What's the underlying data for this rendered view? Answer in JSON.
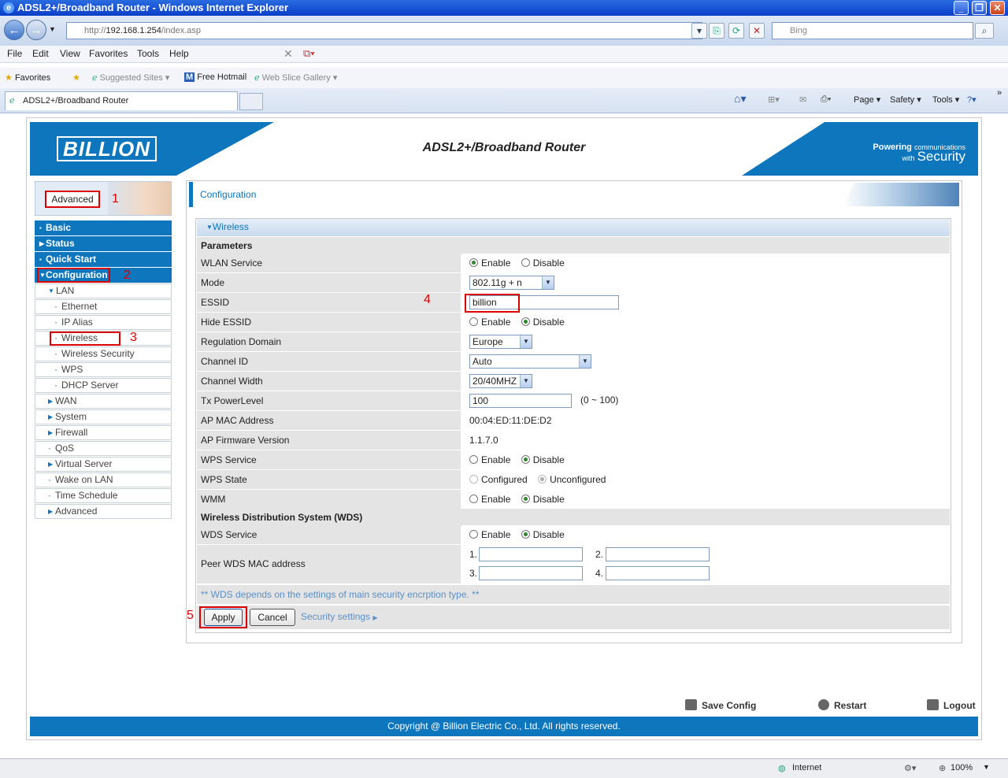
{
  "window": {
    "title": "ADSL2+/Broadband Router - Windows Internet Explorer"
  },
  "address": {
    "scheme": "http://",
    "host": "192.168.1.254",
    "path": "/index.asp"
  },
  "search": {
    "placeholder": "Bing"
  },
  "menu": [
    "File",
    "Edit",
    "View",
    "Favorites",
    "Tools",
    "Help"
  ],
  "favorites": {
    "label": "Favorites",
    "items": [
      "Suggested Sites ▾",
      "Free Hotmail",
      "Web Slice Gallery ▾"
    ]
  },
  "tab": {
    "title": "ADSL2+/Broadband Router"
  },
  "commands": {
    "page": "Page ▾",
    "safety": "Safety ▾",
    "tools": "Tools ▾"
  },
  "banner": {
    "logo": "BILLION",
    "title": "ADSL2+/Broadband Router",
    "powering": "Powering",
    "communications": "communications",
    "with": "with",
    "security": "Security"
  },
  "annotations": [
    "1",
    "2",
    "3",
    "4",
    "5"
  ],
  "sidebar": {
    "mode": "Advanced",
    "main": [
      "Basic",
      "Status",
      "Quick Start",
      "Configuration"
    ],
    "sub": [
      "LAN",
      "Ethernet",
      "IP Alias",
      "Wireless",
      "Wireless Security",
      "WPS",
      "DHCP Server",
      "WAN",
      "System",
      "Firewall",
      "QoS",
      "Virtual Server",
      "Wake on LAN",
      "Time Schedule",
      "Advanced"
    ]
  },
  "content": {
    "header": "Configuration",
    "section": "Wireless",
    "params_title": "Parameters",
    "rows": [
      {
        "label": "WLAN Service",
        "opt1": "Enable",
        "opt2": "Disable",
        "selected": "Enable"
      },
      {
        "label": "Mode",
        "value": "802.11g + n"
      },
      {
        "label": "ESSID",
        "value": "billion"
      },
      {
        "label": "Hide ESSID",
        "opt1": "Enable",
        "opt2": "Disable",
        "selected": "Disable"
      },
      {
        "label": "Regulation Domain",
        "value": "Europe"
      },
      {
        "label": "Channel ID",
        "value": "Auto"
      },
      {
        "label": "Channel Width",
        "value": "20/40MHZ"
      },
      {
        "label": "Tx PowerLevel",
        "value": "100",
        "hint": "(0 ~ 100)"
      },
      {
        "label": "AP MAC Address",
        "value": "00:04:ED:11:DE:D2"
      },
      {
        "label": "AP Firmware Version",
        "value": "1.1.7.0"
      },
      {
        "label": "WPS Service",
        "opt1": "Enable",
        "opt2": "Disable",
        "selected": "Disable"
      },
      {
        "label": "WPS State",
        "opt1": "Configured",
        "opt2": "Unconfigured",
        "selected": "Unconfigured"
      },
      {
        "label": "WMM",
        "opt1": "Enable",
        "opt2": "Disable",
        "selected": "Disable"
      }
    ],
    "wds_title": "Wireless Distribution System (WDS)",
    "wds_service": {
      "label": "WDS Service",
      "opt1": "Enable",
      "opt2": "Disable",
      "selected": "Disable"
    },
    "peer": {
      "label": "Peer WDS MAC address",
      "n1": "1.",
      "n2": "2.",
      "n3": "3.",
      "n4": "4."
    },
    "note": "** WDS depends on the settings of main security encrption type. **",
    "apply": "Apply",
    "cancel": "Cancel",
    "security_link": "Security settings"
  },
  "footer": {
    "save": "Save Config",
    "restart": "Restart",
    "logout": "Logout",
    "copyright": "Copyright @ Billion Electric Co., Ltd. All rights reserved."
  },
  "statusbar": {
    "zone": "Internet",
    "zoom": "100%"
  }
}
